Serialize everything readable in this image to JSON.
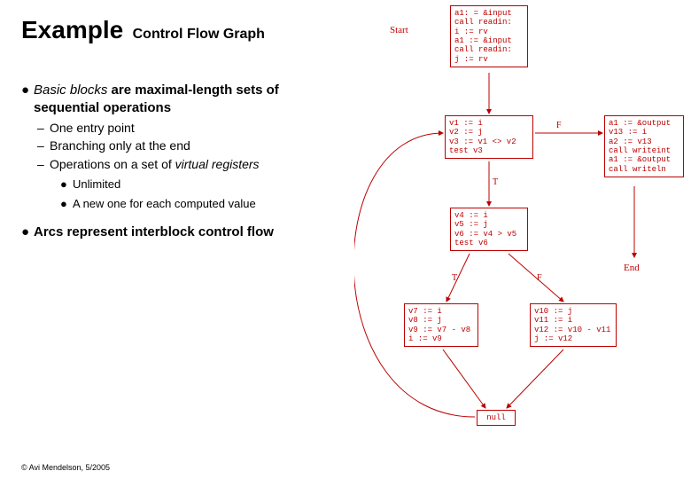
{
  "title": {
    "main": "Example",
    "sub": "Control Flow Graph"
  },
  "bullets": {
    "b1_prefix": "Basic blocks",
    "b1_rest": " are maximal-length sets of sequential operations",
    "d1": "One entry point",
    "d2": "Branching only at the end",
    "d3_prefix": "Operations on a set of ",
    "d3_em": "virtual registers",
    "s1": "Unlimited",
    "s2": "A new one for each computed value",
    "b2": "Arcs represent interblock control flow"
  },
  "labels": {
    "start": "Start",
    "end": "End",
    "null": "null",
    "T": "T",
    "F": "F"
  },
  "nodes": {
    "n_start": "a1: = &input\ncall readin:\ni := rv\na1 := &input\ncall readin:\nj := rv",
    "n_test1": "v1 := i\nv2 := j\nv3 := v1 <> v2\ntest v3",
    "n_output": "a1 := &output\nv13 := i\na2 := v13\ncall writeint\na1 := &output\ncall writeln",
    "n_test2": "v4 := i\nv5 := j\nv6 := v4 > v5\ntest v6",
    "n_left": "v7 := i\nv8 := j\nv9 := v7 - v8\ni := v9",
    "n_right": "v10 := j\nv11 := i\nv12 := v10 - v11\nj := v12"
  },
  "footer": "© Avi Mendelson, 5/2005"
}
